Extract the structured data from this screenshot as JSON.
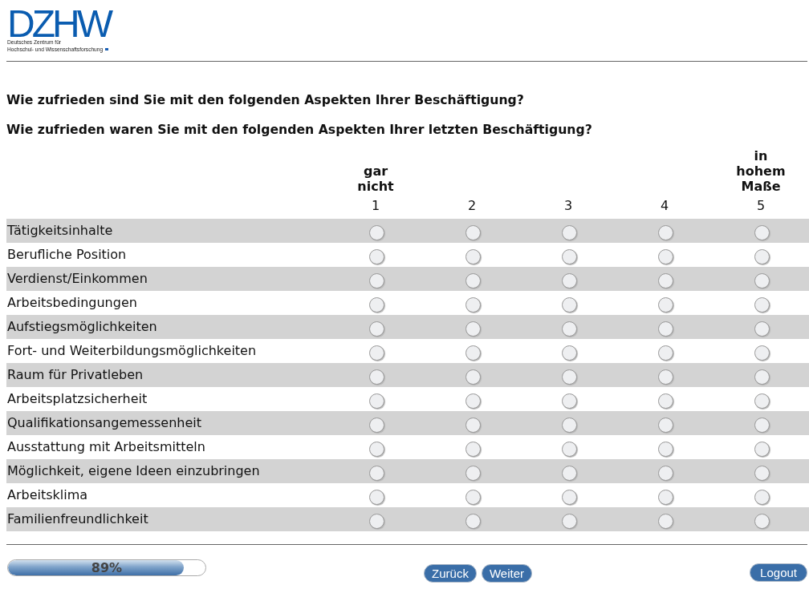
{
  "logo": {
    "wordmark": "DZHW",
    "subtitle_lines": [
      "Deutsches Zentrum für",
      "Hochschul- und Wissenschaftsforschung"
    ]
  },
  "questions": [
    "Wie zufrieden sind Sie mit den folgenden Aspekten Ihrer Beschäftigung?",
    "Wie zufrieden waren Sie mit den folgenden Aspekten Ihrer letzten Beschäftigung?"
  ],
  "scale": [
    {
      "label": "gar nicht",
      "value": "1"
    },
    {
      "value": "2"
    },
    {
      "value": "3"
    },
    {
      "value": "4"
    },
    {
      "label": "in hohem Maße",
      "value": "5"
    }
  ],
  "items": [
    {
      "label": "Tätigkeitsinhalte",
      "options": [
        {
          "selected": false
        },
        {
          "selected": false
        },
        {
          "selected": false
        },
        {
          "selected": false
        },
        {
          "selected": false
        }
      ]
    },
    {
      "label": "Berufliche Position",
      "options": [
        {
          "selected": false
        },
        {
          "selected": false
        },
        {
          "selected": false
        },
        {
          "selected": false
        },
        {
          "selected": false
        }
      ]
    },
    {
      "label": "Verdienst/Einkommen",
      "options": [
        {
          "selected": false
        },
        {
          "selected": false
        },
        {
          "selected": false
        },
        {
          "selected": false
        },
        {
          "selected": false
        }
      ]
    },
    {
      "label": "Arbeitsbedingungen",
      "options": [
        {
          "selected": false
        },
        {
          "selected": false
        },
        {
          "selected": false
        },
        {
          "selected": false
        },
        {
          "selected": false
        }
      ]
    },
    {
      "label": "Aufstiegsmöglichkeiten",
      "options": [
        {
          "selected": false
        },
        {
          "selected": false
        },
        {
          "selected": false
        },
        {
          "selected": false
        },
        {
          "selected": false
        }
      ]
    },
    {
      "label": "Fort- und Weiterbildungsmöglichkeiten",
      "options": [
        {
          "selected": false
        },
        {
          "selected": false
        },
        {
          "selected": false
        },
        {
          "selected": false
        },
        {
          "selected": false
        }
      ]
    },
    {
      "label": "Raum für Privatleben",
      "options": [
        {
          "selected": false
        },
        {
          "selected": false
        },
        {
          "selected": false
        },
        {
          "selected": false
        },
        {
          "selected": false
        }
      ]
    },
    {
      "label": "Arbeitsplatzsicherheit",
      "options": [
        {
          "selected": false
        },
        {
          "selected": false
        },
        {
          "selected": false
        },
        {
          "selected": false
        },
        {
          "selected": false
        }
      ]
    },
    {
      "label": "Qualifikationsangemessenheit",
      "options": [
        {
          "selected": false
        },
        {
          "selected": false
        },
        {
          "selected": false
        },
        {
          "selected": false
        },
        {
          "selected": false
        }
      ]
    },
    {
      "label": "Ausstattung mit Arbeitsmitteln",
      "options": [
        {
          "selected": false
        },
        {
          "selected": false
        },
        {
          "selected": false
        },
        {
          "selected": false
        },
        {
          "selected": false
        }
      ]
    },
    {
      "label": "Möglichkeit, eigene Ideen einzubringen",
      "options": [
        {
          "selected": false
        },
        {
          "selected": false
        },
        {
          "selected": false
        },
        {
          "selected": false
        },
        {
          "selected": false
        }
      ]
    },
    {
      "label": "Arbeitsklima",
      "options": [
        {
          "selected": false
        },
        {
          "selected": false
        },
        {
          "selected": false
        },
        {
          "selected": false
        },
        {
          "selected": false
        }
      ]
    },
    {
      "label": "Familienfreundlichkeit",
      "options": [
        {
          "selected": false
        },
        {
          "selected": false
        },
        {
          "selected": false
        },
        {
          "selected": false
        },
        {
          "selected": false
        }
      ]
    }
  ],
  "progress": {
    "level": 0.89,
    "label": "89%"
  },
  "navigation": [
    {
      "label": "Zurück"
    },
    {
      "label": "Weiter"
    }
  ],
  "logout": {
    "label": "Logout"
  }
}
